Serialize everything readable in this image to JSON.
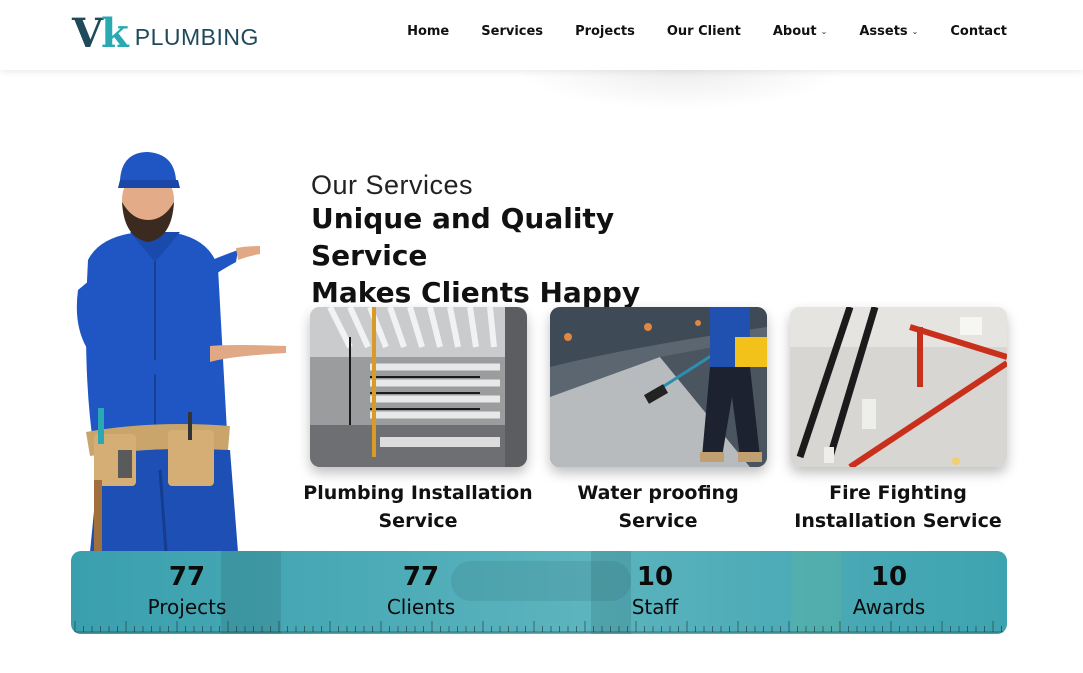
{
  "logo": {
    "mark_v": "V",
    "mark_k": "k",
    "text": "PLUMBING"
  },
  "nav": [
    {
      "label": "Home",
      "dropdown": false
    },
    {
      "label": "Services",
      "dropdown": false
    },
    {
      "label": "Projects",
      "dropdown": false
    },
    {
      "label": "Our Client",
      "dropdown": false
    },
    {
      "label": "About",
      "dropdown": true
    },
    {
      "label": "Assets",
      "dropdown": true
    },
    {
      "label": "Contact",
      "dropdown": false
    }
  ],
  "section": {
    "eyebrow": "Our Services",
    "headline_line1": "Unique and Quality Service",
    "headline_line2": "Makes Clients Happy"
  },
  "services": [
    {
      "title_line1": "Plumbing Installation",
      "title_line2": "Service"
    },
    {
      "title_line1": "Water proofing",
      "title_line2": "Service"
    },
    {
      "title_line1": "Fire Fighting",
      "title_line2": "Installation Service"
    }
  ],
  "stats": [
    {
      "value": "77",
      "label": "Projects"
    },
    {
      "value": "77",
      "label": "Clients"
    },
    {
      "value": "10",
      "label": "Staff"
    },
    {
      "value": "10",
      "label": "Awards"
    }
  ],
  "colors": {
    "brand_dark": "#1f4a5a",
    "brand_teal": "#2aa9b2",
    "stats_bg": "#4aaab6"
  }
}
